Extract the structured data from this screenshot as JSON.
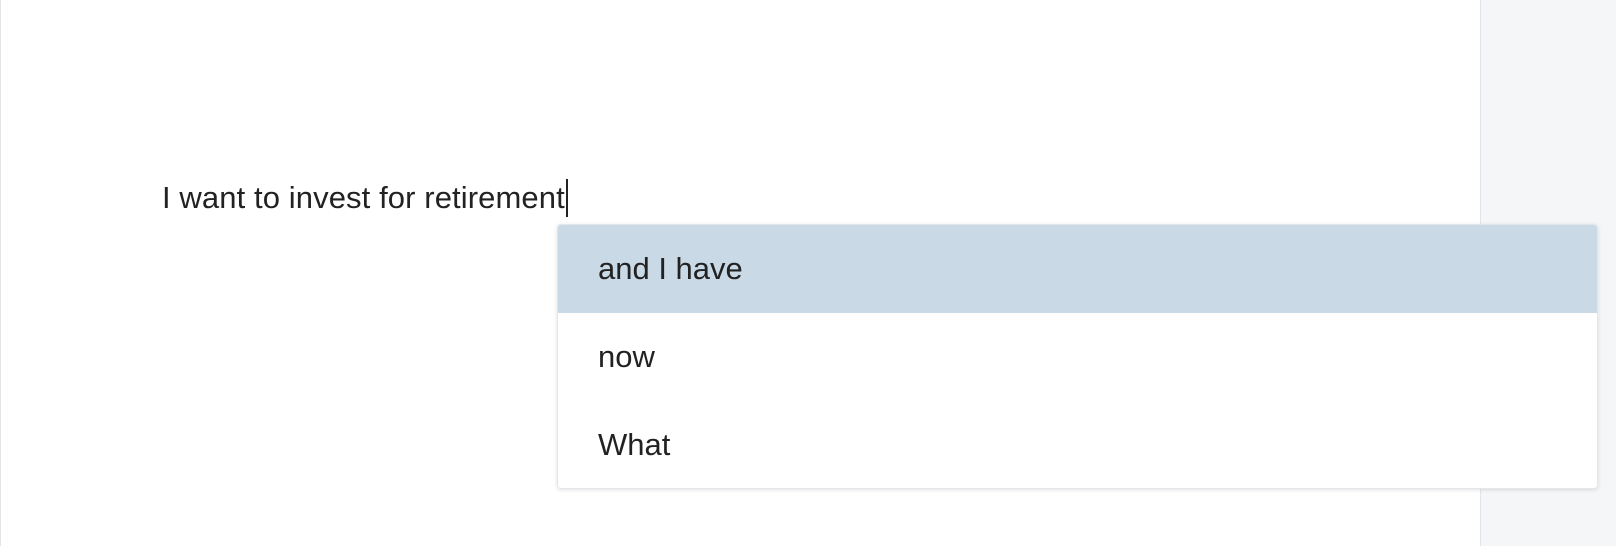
{
  "editor": {
    "text": "I want to invest for retirement"
  },
  "autocomplete": {
    "active_index": 0,
    "active_color": "#c9d9e6",
    "suggestions": [
      {
        "label": "and I have"
      },
      {
        "label": "now"
      },
      {
        "label": "What"
      }
    ]
  }
}
